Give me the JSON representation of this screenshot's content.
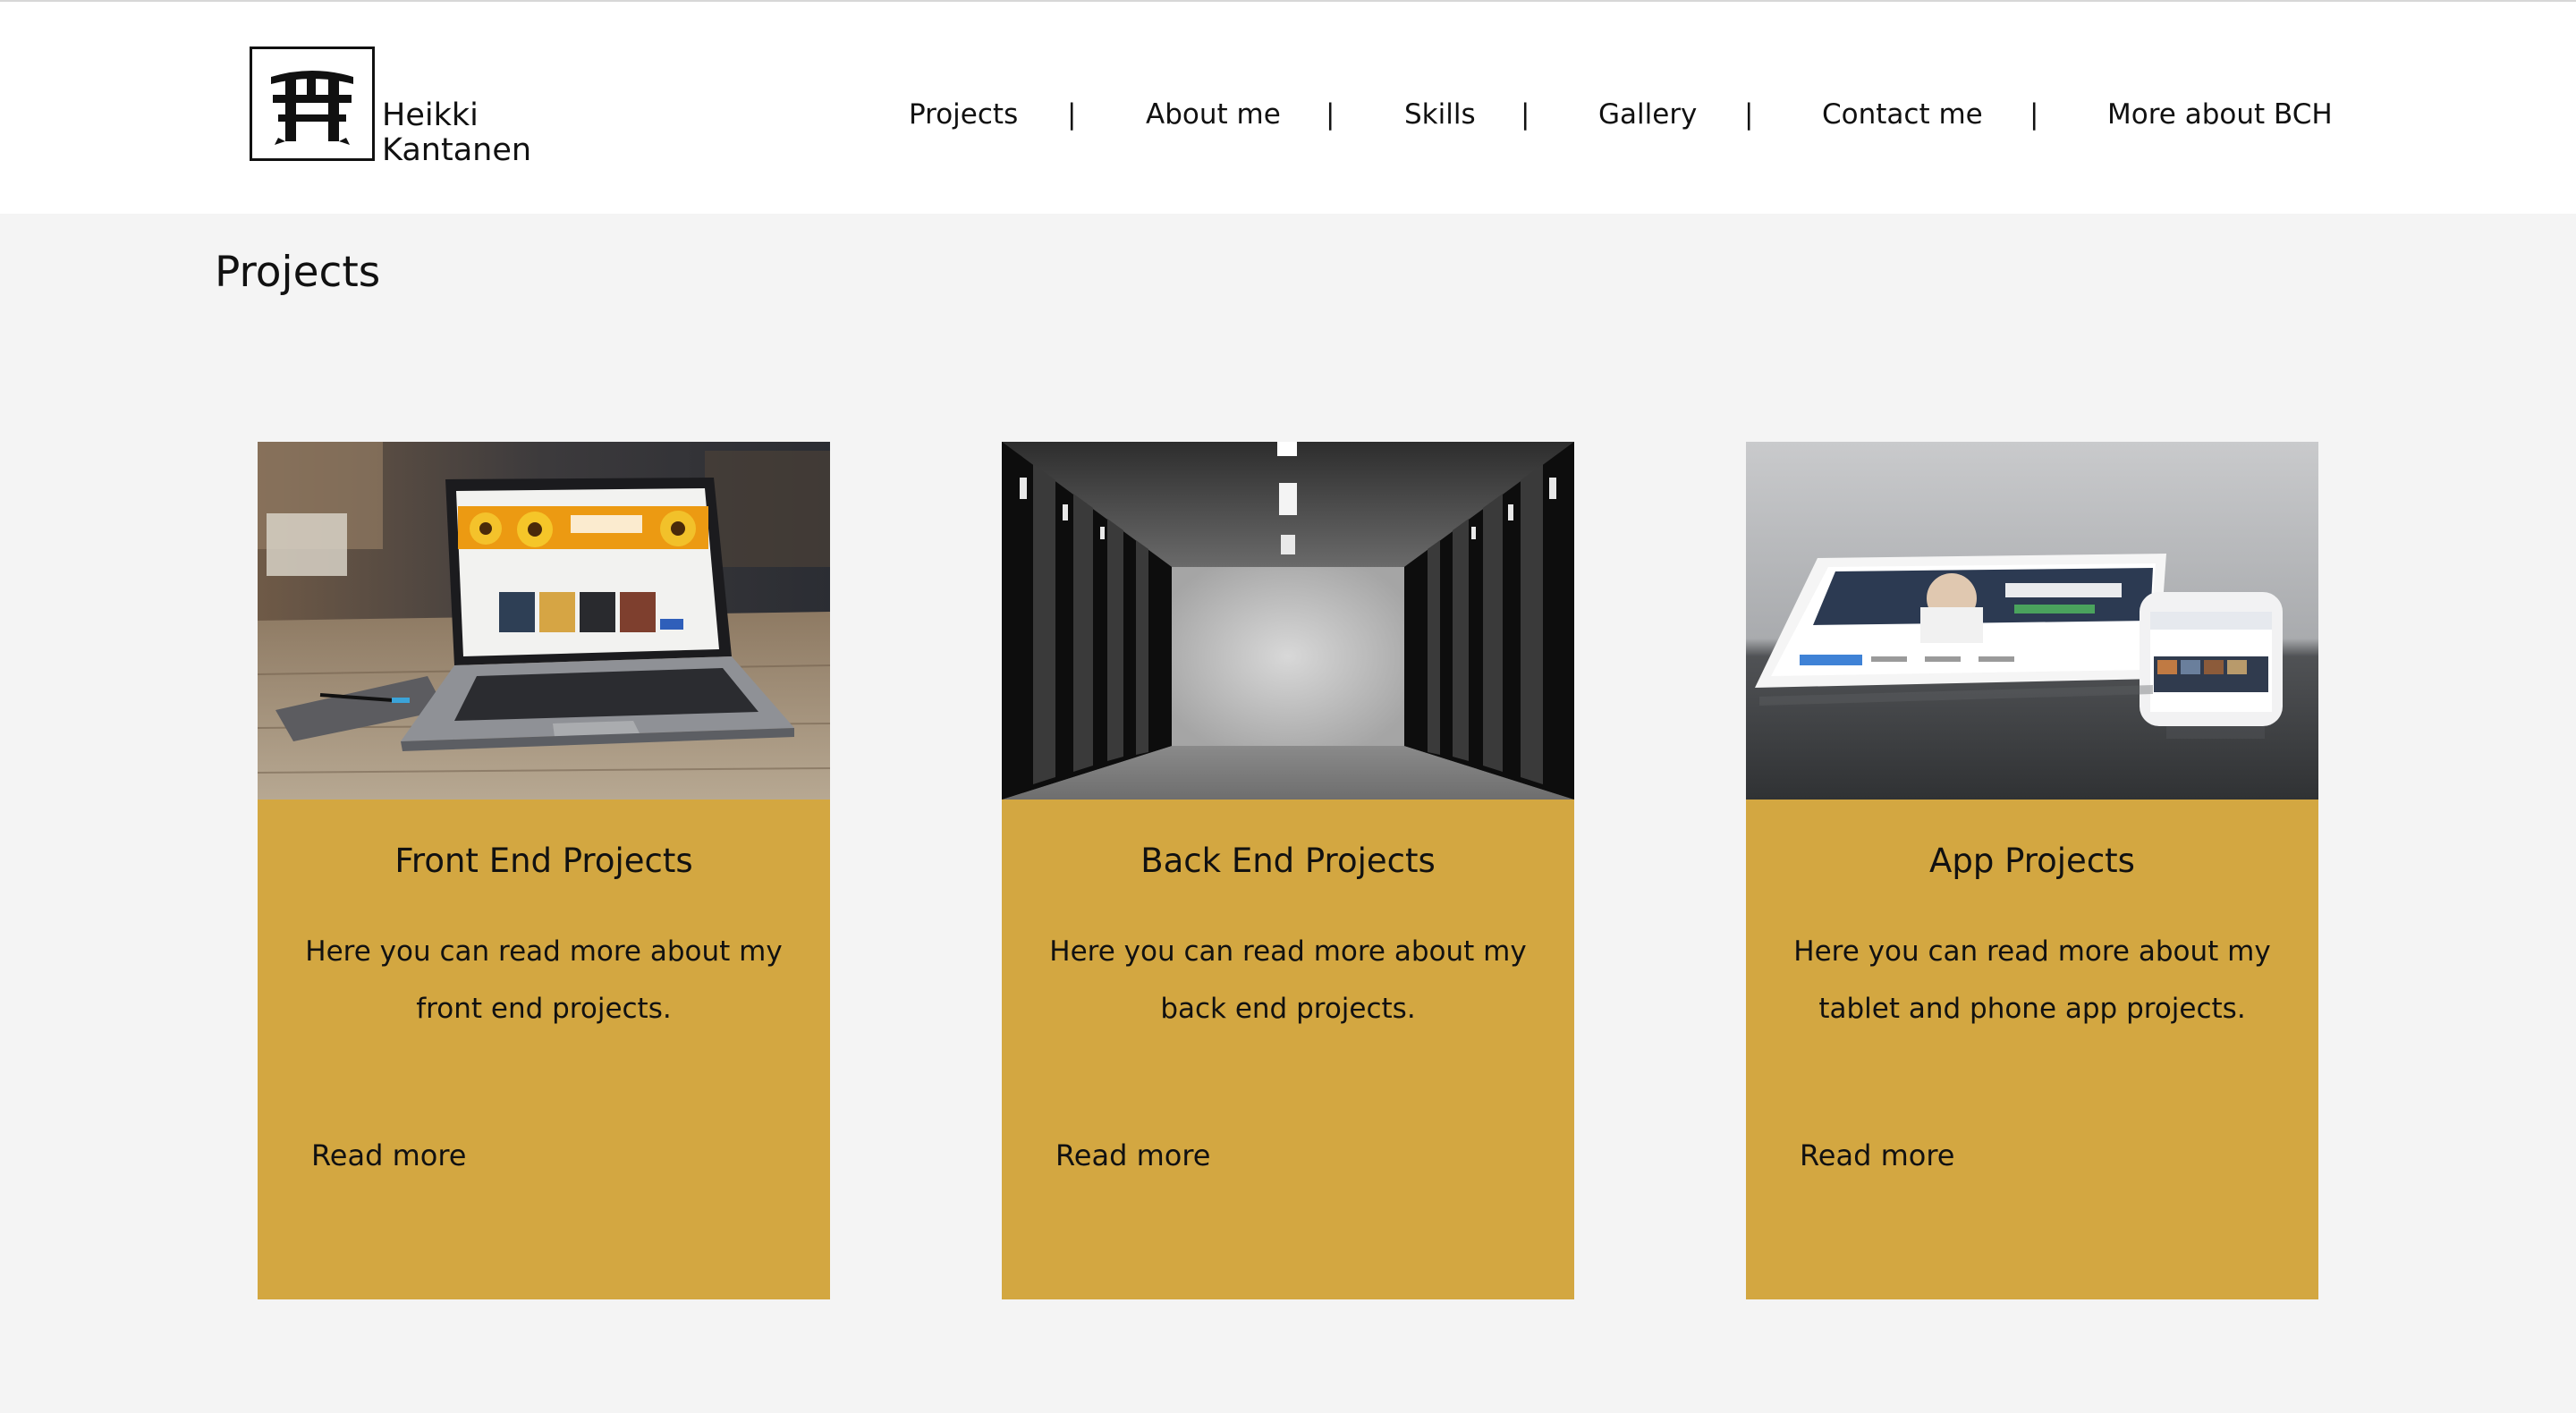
{
  "logo": {
    "name_line1": "Heikki",
    "name_line2": "Kantanen",
    "icon": "torii-gate-icon"
  },
  "nav": {
    "items": [
      "Projects",
      "About me",
      "Skills",
      "Gallery",
      "Contact me",
      "More about BCH"
    ],
    "separator": "|"
  },
  "main": {
    "section_title": "Projects",
    "cards": [
      {
        "title": "Front End Projects",
        "description": "Here you can read more about my front end projects.",
        "link": "Read more",
        "image": "laptop-on-wooden-desk-photo"
      },
      {
        "title": "Back End Projects",
        "description": "Here you can read more about my back end projects.",
        "link": "Read more",
        "image": "server-room-corridor-photo"
      },
      {
        "title": "App Projects",
        "description": "Here you can read more about my tablet and phone app projects.",
        "link": "Read more",
        "image": "tablet-and-phone-photo"
      }
    ]
  },
  "colors": {
    "card_background": "#d3a741",
    "page_background": "#f4f4f4",
    "header_background": "#ffffff",
    "text": "#111111"
  }
}
